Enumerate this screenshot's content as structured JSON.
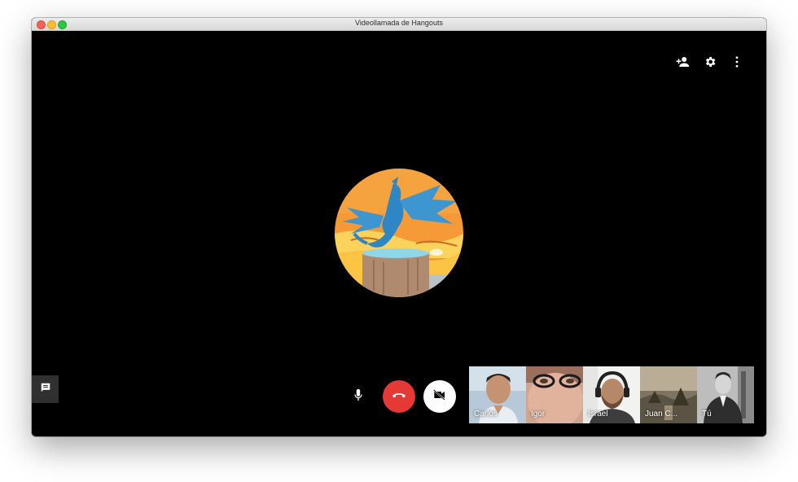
{
  "window": {
    "title": "Videollamada de Hangouts"
  },
  "toolbar": {
    "icons": [
      "add-person-icon",
      "settings-icon",
      "more-vert-icon"
    ]
  },
  "controls": {
    "icons": [
      "chat-icon",
      "microphone-icon",
      "hang-up-icon",
      "video-off-icon"
    ],
    "colors": {
      "hangup": "#e53935",
      "camera": "#ffffff"
    }
  },
  "participants": [
    {
      "name": "Carlos"
    },
    {
      "name": "Igor"
    },
    {
      "name": "Israel"
    },
    {
      "name": "Juan C..."
    },
    {
      "name": "Tú"
    }
  ]
}
